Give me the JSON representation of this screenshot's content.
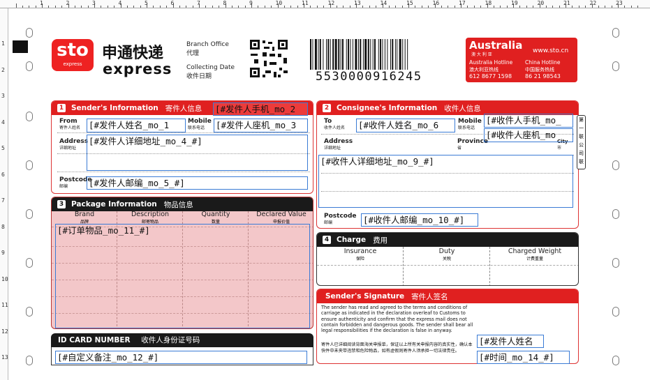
{
  "ruler": {
    "numbers": [
      "1",
      "2",
      "3",
      "4",
      "5",
      "6",
      "7",
      "8",
      "9",
      "10",
      "11",
      "12",
      "13",
      "14",
      "15",
      "16",
      "17",
      "18",
      "19",
      "20",
      "21",
      "22",
      "23"
    ]
  },
  "vruler": {
    "numbers": [
      "1",
      "2",
      "3",
      "4",
      "5",
      "6",
      "7",
      "8",
      "9",
      "10",
      "11",
      "12",
      "13"
    ]
  },
  "header": {
    "logo_text": "sto",
    "logo_sub": "express",
    "brand_cn": "申通快递",
    "brand_en": "express",
    "branch_office": "Branch Office",
    "branch_office_cn": "代理",
    "collecting_date": "Collecting Date",
    "collecting_date_cn": "收件日期",
    "barcode_number": "5530000916245",
    "country": "Australia",
    "country_cn": "澳 大 利 亚",
    "website": "www.sto.cn",
    "hotline_au_label": "Australia Hotline",
    "hotline_au_cn": "澳大利亚热线",
    "hotline_au": "612 8677 1598",
    "hotline_cn_label": "China Hotline",
    "hotline_cn_cn": "中国服务热线",
    "hotline_cn": "86 21 98543"
  },
  "sender": {
    "num": "1",
    "title": "Sender's Information",
    "title_cn": "寄件人信息",
    "from_label": "From",
    "from_cn": "寄件人姓名",
    "mobile_label": "Mobile",
    "mobile_cn": "联系电话",
    "address_label": "Address",
    "address_cn": "详细地址",
    "postcode_label": "Postcode",
    "postcode_cn": "邮编",
    "mobile_field": "[#发件人手机_mo_2",
    "name_field": "[#发件人姓名_mo_1",
    "phone_field": "[#发件人座机_mo_3",
    "address_field": "[#发件人详细地址_mo_4_#]",
    "postcode_field": "[#发件人邮编_mo_5_#]"
  },
  "consignee": {
    "num": "2",
    "title": "Consignee's Information",
    "title_cn": "收件人信息",
    "to_label": "To",
    "to_cn": "收件人姓名",
    "mobile_label": "Mobile",
    "mobile_cn": "联系电话",
    "address_label": "Address",
    "address_cn": "详细地址",
    "province_label": "Province",
    "province_cn": "省",
    "city_label": "City",
    "city_cn": "市",
    "postcode_label": "Postcode",
    "postcode_cn": "邮编",
    "side_cn": "第 一 联 公 司 联",
    "name_field": "[#收件人姓名_mo_6",
    "mobile_field": "[#收件人手机_mo_",
    "phone_field": "[#收件人座机_mo",
    "address_field": "[#收件人详细地址_mo_9_#]",
    "postcode_field": "[#收件人邮编_mo_10_#]"
  },
  "package": {
    "num": "3",
    "title": "Package Information",
    "title_cn": "物品信息",
    "columns": [
      {
        "en": "Brand",
        "cn": "品牌"
      },
      {
        "en": "Description",
        "cn": "邮寄物品"
      },
      {
        "en": "Quantity",
        "cn": "数量"
      },
      {
        "en": "Declared Value",
        "cn": "申报价值"
      }
    ],
    "items_field": "[#订单物品_mo_11_#]"
  },
  "charge": {
    "num": "4",
    "title": "Charge",
    "title_cn": "费用",
    "columns": [
      {
        "en": "Insurance",
        "cn": "保险"
      },
      {
        "en": "Duty",
        "cn": "关税"
      },
      {
        "en": "Charged Weight",
        "cn": "计费重量"
      }
    ]
  },
  "signature": {
    "title": "Sender's Signature",
    "title_cn": "寄件人签名",
    "text_en": "The sender has read and agreed to the terms and conditions of carriage as indicated in the declaration overleaf to Customs to ensure authenticity and confirm that the express mail does not contain forbidden and dangerous goods. The sender shall bear all legal responsibilities if the declaration is false in anyway.",
    "text_cn": "寄件人已详细阅读背面海关申报单，保证以上所有关申报内容的真实性，确认本快件中未夹带违禁和危险物品，如有虚假则寄件人须承担一切法律责任。",
    "name_field": "[#发件人姓名",
    "time_field": "[#时间_mo_14_#]"
  },
  "idcard": {
    "title": "ID CARD NUMBER",
    "title_cn": "收件人身份证号码",
    "remark_field": "[#自定义备注_mo_12_#]"
  }
}
